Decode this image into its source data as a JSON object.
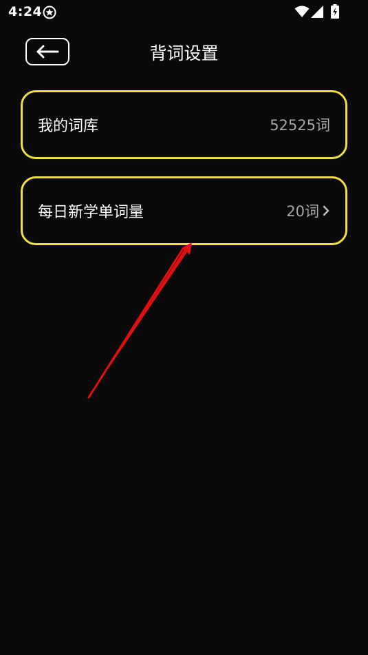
{
  "status_bar": {
    "time": "4:24",
    "app_icon": "shield-badge-icon",
    "icons": [
      "wifi-icon",
      "signal-icon",
      "battery-charging-icon"
    ]
  },
  "nav": {
    "back_icon": "arrow-left-icon",
    "title": "背词设置"
  },
  "settings": [
    {
      "label": "我的词库",
      "value": "52525词",
      "has_chevron": false
    },
    {
      "label": "每日新学单词量",
      "value": "20词",
      "has_chevron": true
    }
  ],
  "colors": {
    "background": "#0a0a0a",
    "card_border": "#f2e040",
    "value_text": "#a6a6a6",
    "annotation_arrow": "#e01010"
  }
}
